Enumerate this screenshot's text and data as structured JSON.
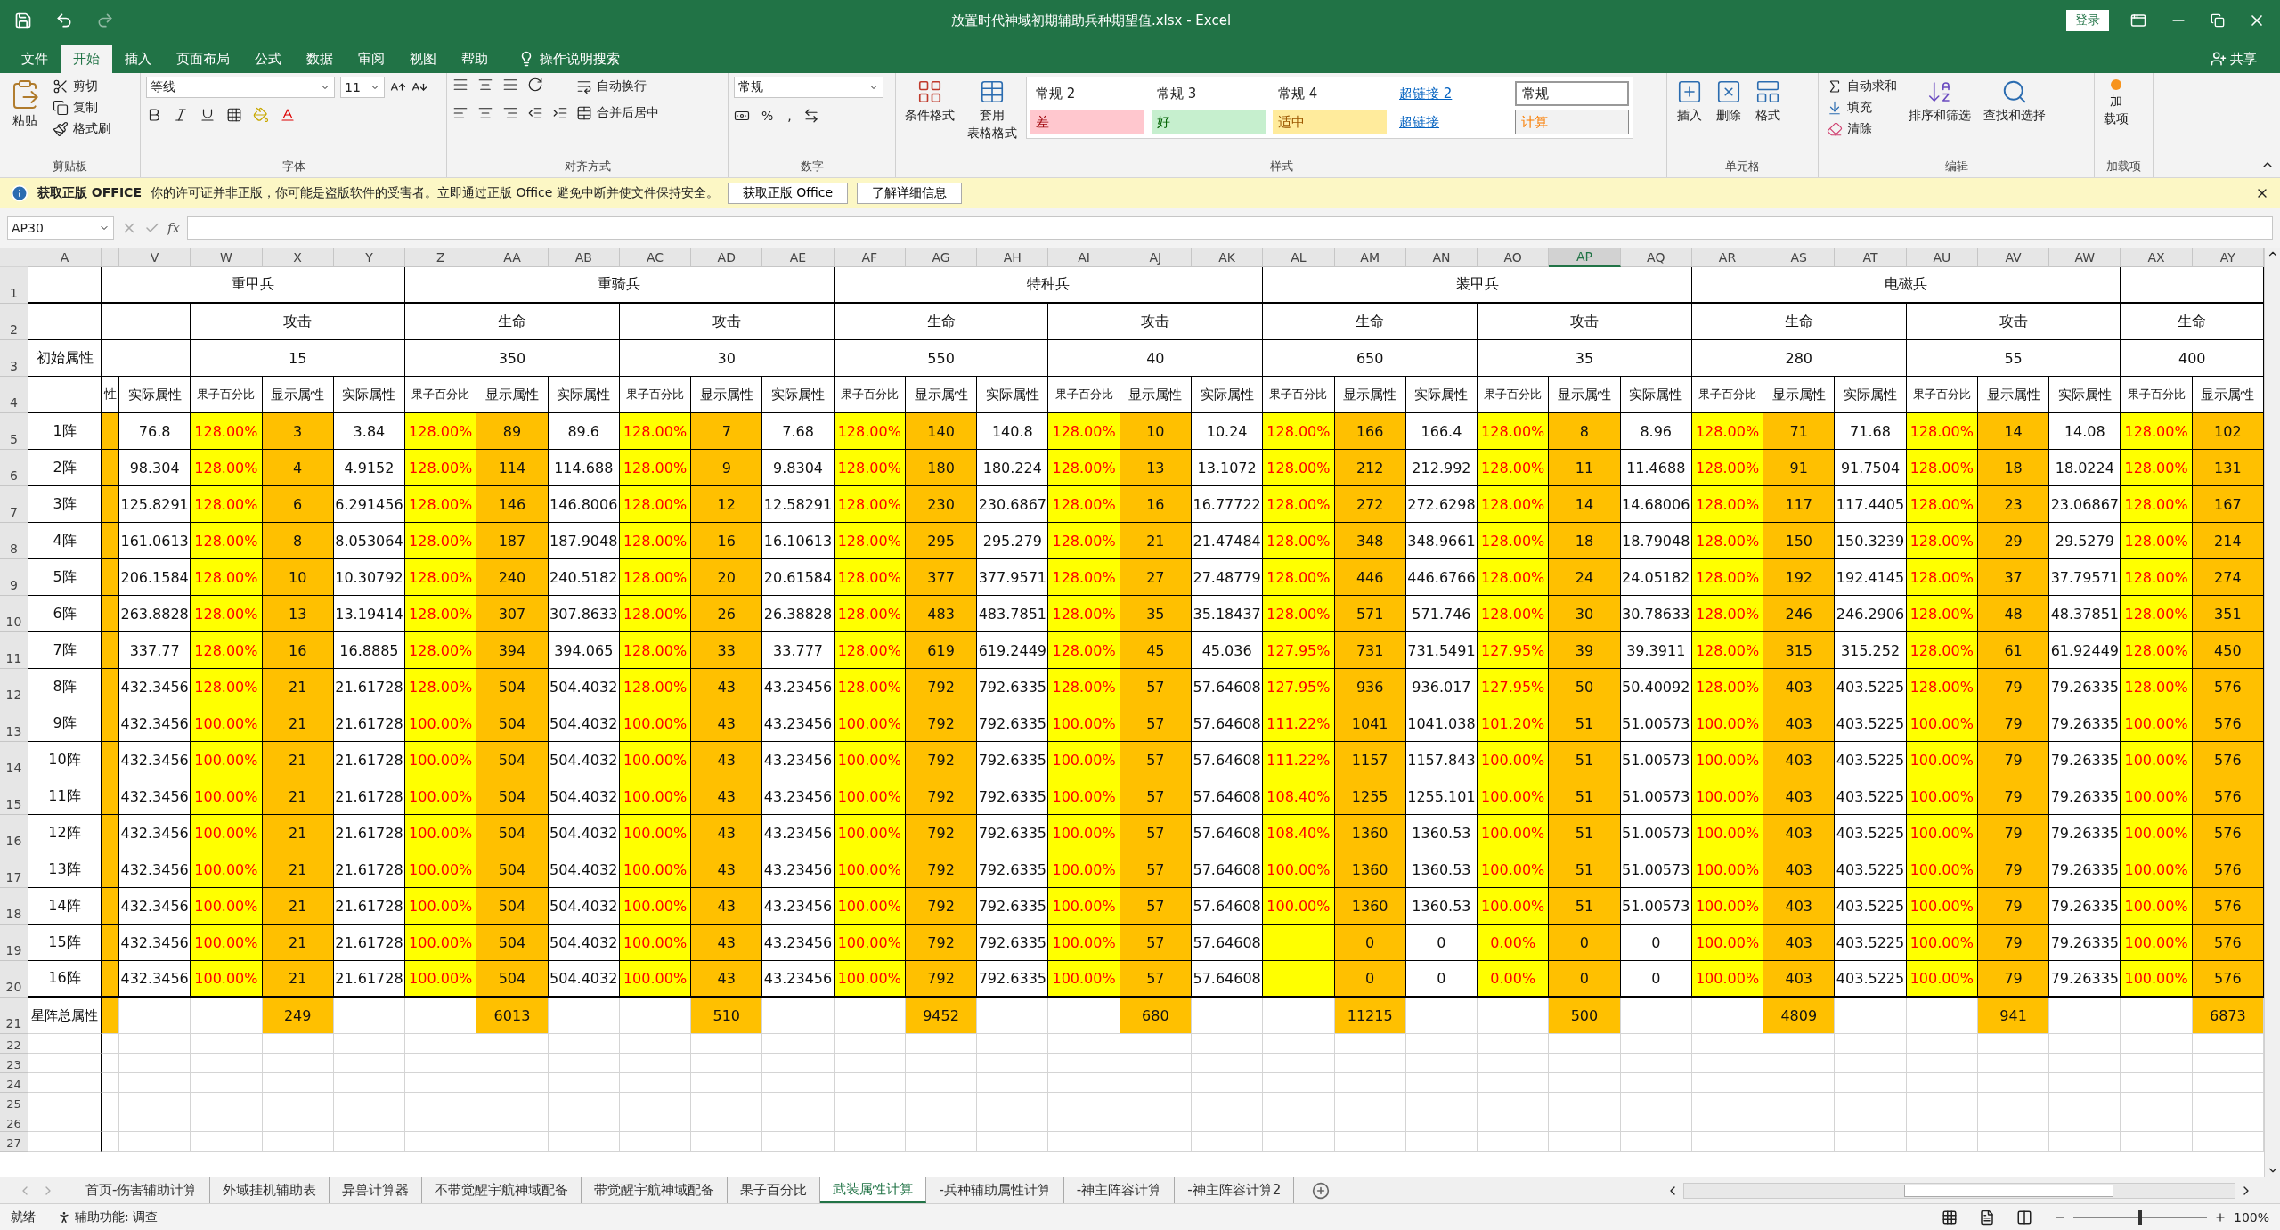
{
  "window": {
    "title": "放置时代神域初期辅助兵种期望值.xlsx  -  Excel",
    "sign_in": "登录"
  },
  "menu_tabs": [
    {
      "label": "文件",
      "selected": false
    },
    {
      "label": "开始",
      "selected": true
    },
    {
      "label": "插入",
      "selected": false
    },
    {
      "label": "页面布局",
      "selected": false
    },
    {
      "label": "公式",
      "selected": false
    },
    {
      "label": "数据",
      "selected": false
    },
    {
      "label": "审阅",
      "selected": false
    },
    {
      "label": "视图",
      "selected": false
    },
    {
      "label": "帮助",
      "selected": false
    }
  ],
  "tell_me": "操作说明搜索",
  "share": "共享",
  "ribbon": {
    "clipboard": {
      "label": "剪贴板",
      "paste": "粘贴",
      "cut": "剪切",
      "copy": "复制",
      "format_painter": "格式刷"
    },
    "font": {
      "label": "字体",
      "font_name": "等线",
      "font_size": "11"
    },
    "alignment": {
      "label": "对齐方式",
      "wrap": "自动换行",
      "merge": "合并后居中"
    },
    "number": {
      "label": "数字",
      "format": "常规",
      "symbols": [
        "%",
        ","
      ]
    },
    "styles": {
      "label": "样式",
      "conditional": [
        "条件格式"
      ],
      "table": [
        "套用",
        "表格格式"
      ],
      "gallery": [
        {
          "label": "常规 2",
          "kind": "normal"
        },
        {
          "label": "常规 3",
          "kind": "normal"
        },
        {
          "label": "常规 4",
          "kind": "normal"
        },
        {
          "label": "超链接 2",
          "kind": "link"
        },
        {
          "label": "常规",
          "kind": "selected"
        },
        {
          "label": "差",
          "kind": "bad"
        },
        {
          "label": "好",
          "kind": "good"
        },
        {
          "label": "适中",
          "kind": "neutral"
        },
        {
          "label": "超链接",
          "kind": "link"
        },
        {
          "label": "计算",
          "kind": "calc"
        }
      ]
    },
    "cells": {
      "label": "单元格",
      "buttons": [
        "插入",
        "删除",
        "格式"
      ]
    },
    "editing": {
      "label": "编辑",
      "autosum": "自动求和",
      "fill": "填充",
      "clear": "清除",
      "sort": "排序和筛选",
      "find": "查找和选择"
    },
    "addins": {
      "label": "加载项",
      "button": [
        "加",
        "载项"
      ]
    }
  },
  "message_bar": {
    "title": "获取正版 OFFICE",
    "text": "你的许可证并非正版，你可能是盗版软件的受害者。立即通过正版 Office 避免中断并使文件保持安全。",
    "buttons": [
      "获取正版 Office",
      "了解详细信息"
    ]
  },
  "formula_bar": {
    "name_box": "AP30",
    "fx": "fx"
  },
  "sheet": {
    "columns": [
      {
        "letter": "A",
        "selected": false
      },
      {
        "letter": "V",
        "selected": false
      },
      {
        "letter": "W",
        "selected": false
      },
      {
        "letter": "X",
        "selected": false
      },
      {
        "letter": "Y",
        "selected": false
      },
      {
        "letter": "Z",
        "selected": false
      },
      {
        "letter": "AA",
        "selected": false
      },
      {
        "letter": "AB",
        "selected": false
      },
      {
        "letter": "AC",
        "selected": false
      },
      {
        "letter": "AD",
        "selected": false
      },
      {
        "letter": "AE",
        "selected": false
      },
      {
        "letter": "AF",
        "selected": false
      },
      {
        "letter": "AG",
        "selected": false
      },
      {
        "letter": "AH",
        "selected": false
      },
      {
        "letter": "AI",
        "selected": false
      },
      {
        "letter": "AJ",
        "selected": false
      },
      {
        "letter": "AK",
        "selected": false
      },
      {
        "letter": "AL",
        "selected": false
      },
      {
        "letter": "AM",
        "selected": false
      },
      {
        "letter": "AN",
        "selected": false
      },
      {
        "letter": "AO",
        "selected": false
      },
      {
        "letter": "AP",
        "selected": true
      },
      {
        "letter": "AQ",
        "selected": false
      },
      {
        "letter": "AR",
        "selected": false
      },
      {
        "letter": "AS",
        "selected": false
      },
      {
        "letter": "AT",
        "selected": false
      },
      {
        "letter": "AU",
        "selected": false
      },
      {
        "letter": "AV",
        "selected": false
      },
      {
        "letter": "AW",
        "selected": false
      },
      {
        "letter": "AX",
        "selected": false
      },
      {
        "letter": "AY",
        "selected": false
      }
    ],
    "row_numbers": [
      "1",
      "2",
      "3",
      "4",
      "5",
      "6",
      "7",
      "8",
      "9",
      "10",
      "11",
      "12",
      "13",
      "14",
      "15",
      "16",
      "17",
      "18",
      "19",
      "20",
      "21",
      "22",
      "23",
      "24",
      "25",
      "26",
      "27"
    ],
    "initial_label": "初始属性",
    "units": [
      "重甲兵",
      "重骑兵",
      "特种兵",
      "装甲兵",
      "电磁兵"
    ],
    "stats": [
      {
        "name": "攻击",
        "value": "15"
      },
      {
        "name": "生命",
        "value": "350"
      },
      {
        "name": "攻击",
        "value": "30"
      },
      {
        "name": "生命",
        "value": "550"
      },
      {
        "name": "攻击",
        "value": "40"
      },
      {
        "name": "生命",
        "value": "650"
      },
      {
        "name": "攻击",
        "value": "35"
      },
      {
        "name": "生命",
        "value": "280"
      },
      {
        "name": "攻击",
        "value": "55"
      },
      {
        "name": "生命",
        "value": "400"
      }
    ],
    "subheaders": [
      {
        "label": "性",
        "kind": "partial"
      },
      {
        "label": "实际属性",
        "kind": "actual"
      },
      {
        "label": "果子百分比",
        "kind": "percent"
      },
      {
        "label": "显示属性",
        "kind": "display"
      },
      {
        "label": "实际属性",
        "kind": "actual"
      },
      {
        "label": "果子百分比",
        "kind": "percent"
      },
      {
        "label": "显示属性",
        "kind": "display"
      },
      {
        "label": "实际属性",
        "kind": "actual"
      },
      {
        "label": "果子百分比",
        "kind": "percent"
      },
      {
        "label": "显示属性",
        "kind": "display"
      },
      {
        "label": "实际属性",
        "kind": "actual"
      },
      {
        "label": "果子百分比",
        "kind": "percent"
      },
      {
        "label": "显示属性",
        "kind": "display"
      },
      {
        "label": "实际属性",
        "kind": "actual"
      },
      {
        "label": "果子百分比",
        "kind": "percent"
      },
      {
        "label": "显示属性",
        "kind": "display"
      },
      {
        "label": "实际属性",
        "kind": "actual"
      },
      {
        "label": "果子百分比",
        "kind": "percent"
      },
      {
        "label": "显示属性",
        "kind": "display"
      },
      {
        "label": "实际属性",
        "kind": "actual"
      },
      {
        "label": "果子百分比",
        "kind": "percent"
      },
      {
        "label": "显示属性",
        "kind": "display"
      },
      {
        "label": "实际属性",
        "kind": "actual"
      },
      {
        "label": "果子百分比",
        "kind": "percent"
      },
      {
        "label": "显示属性",
        "kind": "display"
      },
      {
        "label": "实际属性",
        "kind": "actual"
      },
      {
        "label": "果子百分比",
        "kind": "percent"
      },
      {
        "label": "显示属性",
        "kind": "display"
      },
      {
        "label": "实际属性",
        "kind": "actual"
      },
      {
        "label": "果子百分比",
        "kind": "percent"
      },
      {
        "label": "显示属性",
        "kind": "display"
      }
    ],
    "rows": [
      {
        "label": "1阵",
        "cells": [
          null,
          "76.8",
          "128.00%",
          "3",
          "3.84",
          "128.00%",
          "89",
          "89.6",
          "128.00%",
          "7",
          "7.68",
          "128.00%",
          "140",
          "140.8",
          "128.00%",
          "10",
          "10.24",
          "128.00%",
          "166",
          "166.4",
          "128.00%",
          "8",
          "8.96",
          "128.00%",
          "71",
          "71.68",
          "128.00%",
          "14",
          "14.08",
          "128.00%",
          "102"
        ]
      },
      {
        "label": "2阵",
        "cells": [
          null,
          "98.304",
          "128.00%",
          "4",
          "4.9152",
          "128.00%",
          "114",
          "114.688",
          "128.00%",
          "9",
          "9.8304",
          "128.00%",
          "180",
          "180.224",
          "128.00%",
          "13",
          "13.1072",
          "128.00%",
          "212",
          "212.992",
          "128.00%",
          "11",
          "11.4688",
          "128.00%",
          "91",
          "91.7504",
          "128.00%",
          "18",
          "18.0224",
          "128.00%",
          "131"
        ]
      },
      {
        "label": "3阵",
        "cells": [
          null,
          "125.8291",
          "128.00%",
          "6",
          "6.291456",
          "128.00%",
          "146",
          "146.8006",
          "128.00%",
          "12",
          "12.58291",
          "128.00%",
          "230",
          "230.6867",
          "128.00%",
          "16",
          "16.77722",
          "128.00%",
          "272",
          "272.6298",
          "128.00%",
          "14",
          "14.68006",
          "128.00%",
          "117",
          "117.4405",
          "128.00%",
          "23",
          "23.06867",
          "128.00%",
          "167"
        ]
      },
      {
        "label": "4阵",
        "cells": [
          null,
          "161.0613",
          "128.00%",
          "8",
          "8.053064",
          "128.00%",
          "187",
          "187.9048",
          "128.00%",
          "16",
          "16.10613",
          "128.00%",
          "295",
          "295.279",
          "128.00%",
          "21",
          "21.47484",
          "128.00%",
          "348",
          "348.9661",
          "128.00%",
          "18",
          "18.79048",
          "128.00%",
          "150",
          "150.3239",
          "128.00%",
          "29",
          "29.5279",
          "128.00%",
          "214"
        ]
      },
      {
        "label": "5阵",
        "cells": [
          null,
          "206.1584",
          "128.00%",
          "10",
          "10.30792",
          "128.00%",
          "240",
          "240.5182",
          "128.00%",
          "20",
          "20.61584",
          "128.00%",
          "377",
          "377.9571",
          "128.00%",
          "27",
          "27.48779",
          "128.00%",
          "446",
          "446.6766",
          "128.00%",
          "24",
          "24.05182",
          "128.00%",
          "192",
          "192.4145",
          "128.00%",
          "37",
          "37.79571",
          "128.00%",
          "274"
        ]
      },
      {
        "label": "6阵",
        "cells": [
          null,
          "263.8828",
          "128.00%",
          "13",
          "13.19414",
          "128.00%",
          "307",
          "307.8633",
          "128.00%",
          "26",
          "26.38828",
          "128.00%",
          "483",
          "483.7851",
          "128.00%",
          "35",
          "35.18437",
          "128.00%",
          "571",
          "571.746",
          "128.00%",
          "30",
          "30.78633",
          "128.00%",
          "246",
          "246.2906",
          "128.00%",
          "48",
          "48.37851",
          "128.00%",
          "351"
        ]
      },
      {
        "label": "7阵",
        "cells": [
          null,
          "337.77",
          "128.00%",
          "16",
          "16.8885",
          "128.00%",
          "394",
          "394.065",
          "128.00%",
          "33",
          "33.777",
          "128.00%",
          "619",
          "619.2449",
          "128.00%",
          "45",
          "45.036",
          "127.95%",
          "731",
          "731.5491",
          "127.95%",
          "39",
          "39.3911",
          "128.00%",
          "315",
          "315.252",
          "128.00%",
          "61",
          "61.92449",
          "128.00%",
          "450"
        ]
      },
      {
        "label": "8阵",
        "cells": [
          null,
          "432.3456",
          "128.00%",
          "21",
          "21.61728",
          "128.00%",
          "504",
          "504.4032",
          "128.00%",
          "43",
          "43.23456",
          "128.00%",
          "792",
          "792.6335",
          "128.00%",
          "57",
          "57.64608",
          "127.95%",
          "936",
          "936.017",
          "127.95%",
          "50",
          "50.40092",
          "128.00%",
          "403",
          "403.5225",
          "128.00%",
          "79",
          "79.26335",
          "128.00%",
          "576"
        ]
      },
      {
        "label": "9阵",
        "cells": [
          null,
          "432.3456",
          "100.00%",
          "21",
          "21.61728",
          "100.00%",
          "504",
          "504.4032",
          "100.00%",
          "43",
          "43.23456",
          "100.00%",
          "792",
          "792.6335",
          "100.00%",
          "57",
          "57.64608",
          "111.22%",
          "1041",
          "1041.038",
          "101.20%",
          "51",
          "51.00573",
          "100.00%",
          "403",
          "403.5225",
          "100.00%",
          "79",
          "79.26335",
          "100.00%",
          "576"
        ]
      },
      {
        "label": "10阵",
        "cells": [
          null,
          "432.3456",
          "100.00%",
          "21",
          "21.61728",
          "100.00%",
          "504",
          "504.4032",
          "100.00%",
          "43",
          "43.23456",
          "100.00%",
          "792",
          "792.6335",
          "100.00%",
          "57",
          "57.64608",
          "111.22%",
          "1157",
          "1157.843",
          "100.00%",
          "51",
          "51.00573",
          "100.00%",
          "403",
          "403.5225",
          "100.00%",
          "79",
          "79.26335",
          "100.00%",
          "576"
        ]
      },
      {
        "label": "11阵",
        "cells": [
          null,
          "432.3456",
          "100.00%",
          "21",
          "21.61728",
          "100.00%",
          "504",
          "504.4032",
          "100.00%",
          "43",
          "43.23456",
          "100.00%",
          "792",
          "792.6335",
          "100.00%",
          "57",
          "57.64608",
          "108.40%",
          "1255",
          "1255.101",
          "100.00%",
          "51",
          "51.00573",
          "100.00%",
          "403",
          "403.5225",
          "100.00%",
          "79",
          "79.26335",
          "100.00%",
          "576"
        ]
      },
      {
        "label": "12阵",
        "cells": [
          null,
          "432.3456",
          "100.00%",
          "21",
          "21.61728",
          "100.00%",
          "504",
          "504.4032",
          "100.00%",
          "43",
          "43.23456",
          "100.00%",
          "792",
          "792.6335",
          "100.00%",
          "57",
          "57.64608",
          "108.40%",
          "1360",
          "1360.53",
          "100.00%",
          "51",
          "51.00573",
          "100.00%",
          "403",
          "403.5225",
          "100.00%",
          "79",
          "79.26335",
          "100.00%",
          "576"
        ]
      },
      {
        "label": "13阵",
        "cells": [
          null,
          "432.3456",
          "100.00%",
          "21",
          "21.61728",
          "100.00%",
          "504",
          "504.4032",
          "100.00%",
          "43",
          "43.23456",
          "100.00%",
          "792",
          "792.6335",
          "100.00%",
          "57",
          "57.64608",
          "100.00%",
          "1360",
          "1360.53",
          "100.00%",
          "51",
          "51.00573",
          "100.00%",
          "403",
          "403.5225",
          "100.00%",
          "79",
          "79.26335",
          "100.00%",
          "576"
        ]
      },
      {
        "label": "14阵",
        "cells": [
          null,
          "432.3456",
          "100.00%",
          "21",
          "21.61728",
          "100.00%",
          "504",
          "504.4032",
          "100.00%",
          "43",
          "43.23456",
          "100.00%",
          "792",
          "792.6335",
          "100.00%",
          "57",
          "57.64608",
          "100.00%",
          "1360",
          "1360.53",
          "100.00%",
          "51",
          "51.00573",
          "100.00%",
          "403",
          "403.5225",
          "100.00%",
          "79",
          "79.26335",
          "100.00%",
          "576"
        ]
      },
      {
        "label": "15阵",
        "cells": [
          null,
          "432.3456",
          "100.00%",
          "21",
          "21.61728",
          "100.00%",
          "504",
          "504.4032",
          "100.00%",
          "43",
          "43.23456",
          "100.00%",
          "792",
          "792.6335",
          "100.00%",
          "57",
          "57.64608",
          null,
          "0",
          "0",
          "0.00%",
          "0",
          "0",
          "100.00%",
          "403",
          "403.5225",
          "100.00%",
          "79",
          "79.26335",
          "100.00%",
          "576"
        ]
      },
      {
        "label": "16阵",
        "cells": [
          null,
          "432.3456",
          "100.00%",
          "21",
          "21.61728",
          "100.00%",
          "504",
          "504.4032",
          "100.00%",
          "43",
          "43.23456",
          "100.00%",
          "792",
          "792.6335",
          "100.00%",
          "57",
          "57.64608",
          null,
          "0",
          "0",
          "0.00%",
          "0",
          "0",
          "100.00%",
          "403",
          "403.5225",
          "100.00%",
          "79",
          "79.26335",
          "100.00%",
          "576"
        ]
      }
    ],
    "total_row": {
      "label": "星阵总属性",
      "cells": [
        null,
        null,
        null,
        "249",
        null,
        null,
        "6013",
        null,
        null,
        "510",
        null,
        null,
        "9452",
        null,
        null,
        "680",
        null,
        null,
        "11215",
        null,
        null,
        "500",
        null,
        null,
        "4809",
        null,
        null,
        "941",
        null,
        null,
        "6873"
      ]
    }
  },
  "sheet_tabs": [
    {
      "label": "首页-伤害辅助计算",
      "selected": false
    },
    {
      "label": "外域挂机辅助表",
      "selected": false
    },
    {
      "label": "异兽计算器",
      "selected": false
    },
    {
      "label": "不带觉醒宇航神域配备",
      "selected": false
    },
    {
      "label": "带觉醒宇航神域配备",
      "selected": false
    },
    {
      "label": "果子百分比",
      "selected": false
    },
    {
      "label": "武装属性计算",
      "selected": true
    },
    {
      "label": "-兵种辅助属性计算",
      "selected": false
    },
    {
      "label": "-神主阵容计算",
      "selected": false
    },
    {
      "label": "-神主阵容计算2",
      "selected": false
    }
  ],
  "status_bar": {
    "ready": "就绪",
    "accessibility": "辅助功能: 调查",
    "zoom": {
      "level": 0.5,
      "reading": "100%"
    }
  }
}
